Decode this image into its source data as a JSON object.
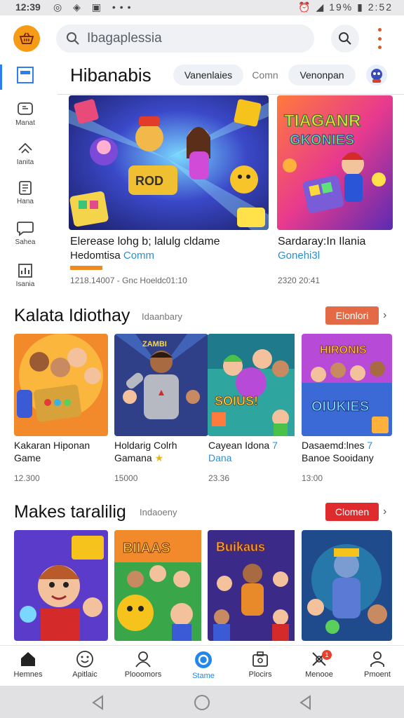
{
  "status_bar": {
    "time": "12:39",
    "battery": "19%",
    "clock_right": "2:52"
  },
  "search": {
    "placeholder": "Ibagaplessia"
  },
  "side_rail": [
    {
      "label": "",
      "icon": "home-screen-icon"
    },
    {
      "label": "Manat",
      "icon": "chat-icon"
    },
    {
      "label": "Ianita",
      "icon": "arrows-icon"
    },
    {
      "label": "Hana",
      "icon": "document-icon"
    },
    {
      "label": "Sahea",
      "icon": "message-icon"
    },
    {
      "label": "Isania",
      "icon": "chart-icon"
    }
  ],
  "header": {
    "title": "Hibanabis",
    "chips": [
      "Vanenlaies",
      "Comn",
      "Venonpan"
    ]
  },
  "featured": [
    {
      "title": "Elerease lohg b; lalulg cldame",
      "sub_plain": "Hedomtisa",
      "sub_accent": "Comm",
      "meta": "1218.14007 - Gnc Hoeldc01:10"
    },
    {
      "title": "Sardaray:In Ilania",
      "sub_plain": "",
      "sub_accent": "Gonehi3l",
      "meta": "2320 20:41"
    }
  ],
  "sections": [
    {
      "title": "Kalata Idiothay",
      "subtitle": "Idaanbary",
      "button": "Elonlori",
      "button_color": "#e46a45",
      "cards": [
        {
          "line1": "Kakaran Hiponan",
          "line2": "Game",
          "accent": "",
          "meta": "12.300"
        },
        {
          "line1": "Holdarig Colrh",
          "line2": "Gamana",
          "accent": "★",
          "meta": "15000"
        },
        {
          "line1": "Cayean Idona",
          "line2": "Dana",
          "accent": "7",
          "meta": "23.36"
        },
        {
          "line1": "Dasaemd:lnes",
          "line2": "Banoe Sooidany",
          "accent": "7",
          "meta": "13:00"
        }
      ]
    },
    {
      "title": "Makes taralilig",
      "subtitle": "Indaoeny",
      "button": "Clomen",
      "button_color": "#df2a2e",
      "cards": []
    }
  ],
  "bottom_nav": [
    {
      "label": "Hemnes",
      "icon": "home-icon",
      "active": false
    },
    {
      "label": "Apitlaic",
      "icon": "smiley-icon",
      "active": false
    },
    {
      "label": "Plooomors",
      "icon": "person-icon",
      "active": false
    },
    {
      "label": "Stame",
      "icon": "ring-icon",
      "active": true
    },
    {
      "label": "Plocirs",
      "icon": "briefcase-icon",
      "active": false
    },
    {
      "label": "Menooe",
      "icon": "tools-icon",
      "active": false,
      "badge": "1"
    },
    {
      "label": "Pmoent",
      "icon": "profile-icon",
      "active": false
    }
  ]
}
